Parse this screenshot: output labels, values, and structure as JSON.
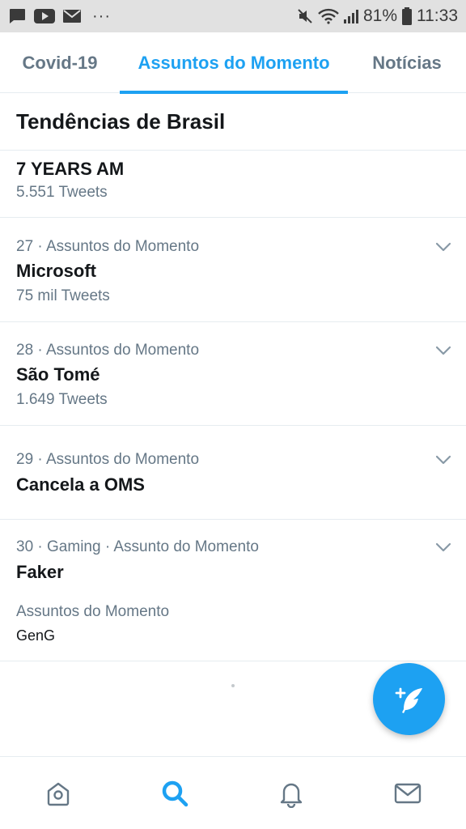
{
  "status_bar": {
    "battery": "81%",
    "time": "11:33",
    "overflow": "···",
    "left_icons": [
      "chat-notification-icon",
      "youtube-icon",
      "email-icon"
    ],
    "right_icons": [
      "mute-icon",
      "wifi-icon",
      "signal-icon",
      "battery-icon"
    ]
  },
  "tabs": [
    {
      "label": "Covid-19",
      "active": false
    },
    {
      "label": "Assuntos do Momento",
      "active": true
    },
    {
      "label": "Notícias",
      "active": false
    }
  ],
  "section": {
    "title": "Tendências de Brasil"
  },
  "trends": [
    {
      "meta": "",
      "name": "7 YEARS AM",
      "count": "5.551 Tweets"
    },
    {
      "meta": "27 · Assuntos do Momento",
      "name": "Microsoft",
      "count": "75 mil Tweets"
    },
    {
      "meta": "28 · Assuntos do Momento",
      "name": "São Tomé",
      "count": "1.649 Tweets"
    },
    {
      "meta": "29 · Assuntos do Momento",
      "name": "Cancela a OMS",
      "count": ""
    },
    {
      "meta": "30 · Gaming · Assunto do Momento",
      "name": "Faker",
      "count": "",
      "related_label": "Assuntos do Momento",
      "related_value": "GenG"
    }
  ],
  "fab": {
    "icon": "compose-tweet-icon"
  },
  "bottom_nav": [
    {
      "icon": "home-icon",
      "active": false
    },
    {
      "icon": "search-icon",
      "active": true
    },
    {
      "icon": "notifications-bell-icon",
      "active": false
    },
    {
      "icon": "messages-envelope-icon",
      "active": false
    }
  ],
  "colors": {
    "accent": "#1da1f2",
    "text": "#14171a",
    "secondary": "#657786",
    "divider": "#e6ecf0",
    "status_bar_bg": "#e1e1e1"
  }
}
